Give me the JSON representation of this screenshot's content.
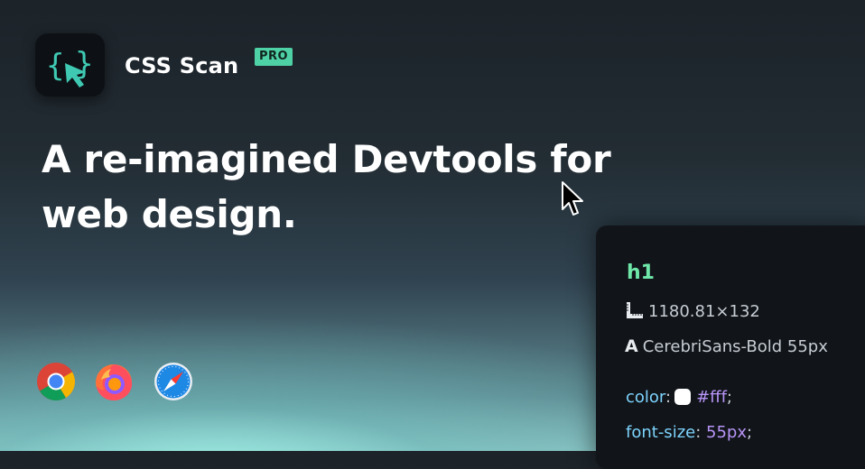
{
  "app": {
    "name": "CSS Scan",
    "badge": "PRO",
    "logo_icon": "braces-cursor-icon",
    "accent_color": "#4fd1a6"
  },
  "hero": {
    "headline": "A re-imagined Devtools for web design."
  },
  "browsers": [
    {
      "name": "Chrome",
      "icon": "chrome-icon"
    },
    {
      "name": "Firefox",
      "icon": "firefox-icon"
    },
    {
      "name": "Safari",
      "icon": "safari-icon"
    }
  ],
  "inspector": {
    "tag": "h1",
    "dimensions": "1180.81×132",
    "font": "CerebriSans-Bold 55px",
    "properties": [
      {
        "name": "color",
        "value": "#fff",
        "swatch": "#ffffff"
      },
      {
        "name": "font-size",
        "value": "55px"
      }
    ]
  }
}
